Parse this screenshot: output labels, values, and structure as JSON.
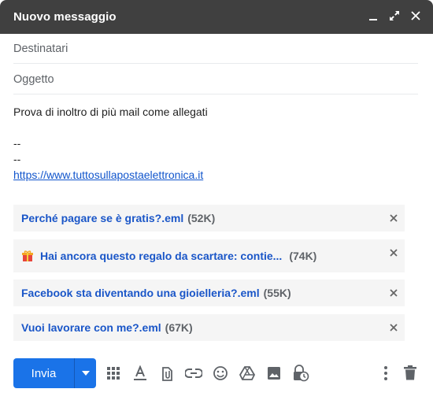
{
  "window": {
    "title": "Nuovo messaggio",
    "controls": [
      "minimize-icon",
      "expand-icon",
      "close-icon"
    ]
  },
  "fields": {
    "to_placeholder": "Destinatari",
    "subject_placeholder": "Oggetto"
  },
  "message": {
    "line1": "Prova di inoltro di più mail come allegati",
    "sig1": "--",
    "sig2": "--",
    "link": "https://www.tuttosullapostaelettronica.it"
  },
  "attachments": [
    {
      "name": "Perché pagare se è gratis?.eml",
      "size": "(52K)"
    },
    {
      "name": "Hai ancora questo regalo da scartare: contie...",
      "size": "(74K)",
      "icon": "gift-icon"
    },
    {
      "name": "Facebook sta diventando una gioielleria?.eml",
      "size": "(55K)"
    },
    {
      "name": "Vuoi lavorare con me?.eml",
      "size": "(67K)"
    }
  ],
  "toolbar": {
    "send_label": "Invia",
    "tools": [
      "grid-icon",
      "text-format-icon",
      "attach-file-icon",
      "link-icon",
      "emoji-icon",
      "drive-icon",
      "image-icon",
      "confidential-mode-icon",
      "more-options-icon",
      "trash-icon"
    ]
  },
  "colors": {
    "titlebar": "#404040",
    "accent": "#1a73e8",
    "link": "#1155cc",
    "attachment_link": "#1a56c8",
    "attachment_bg": "#f5f5f5"
  }
}
